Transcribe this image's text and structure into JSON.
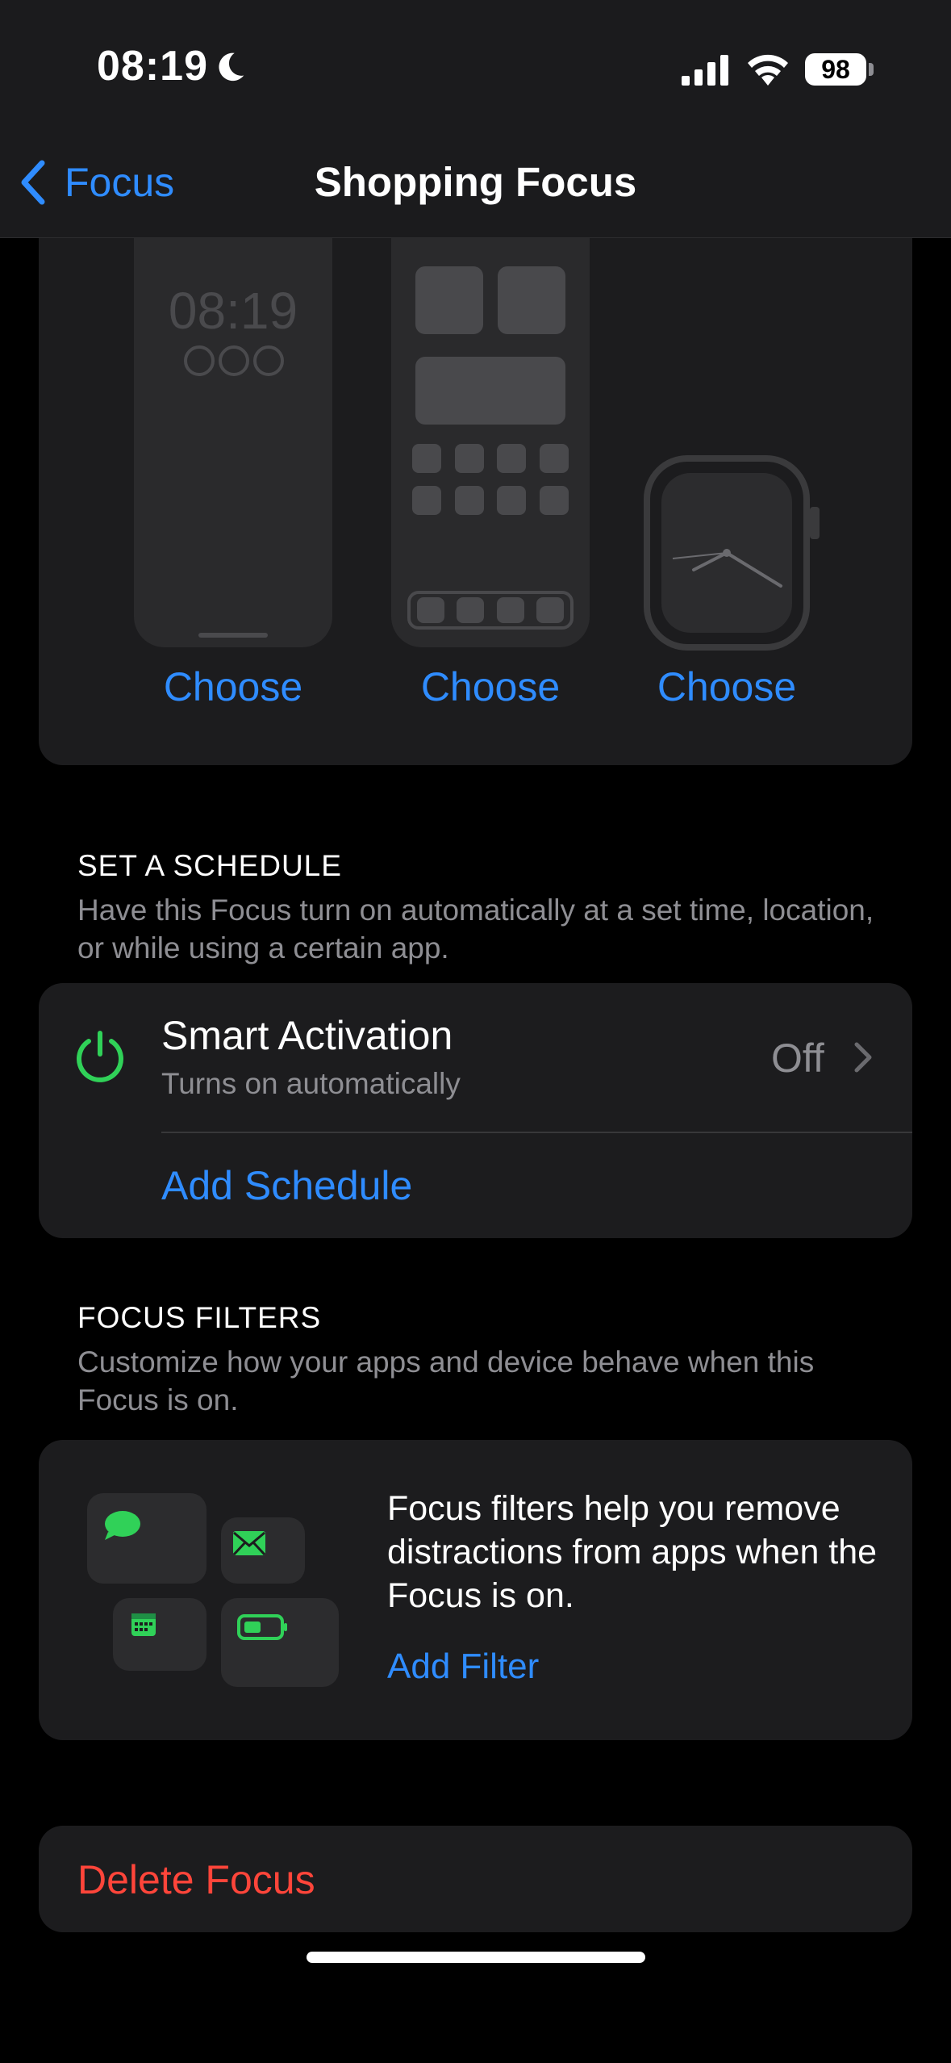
{
  "status": {
    "time": "08:19",
    "battery": "98"
  },
  "nav": {
    "back_label": "Focus",
    "title": "Shopping Focus"
  },
  "preview": {
    "lock_clock": "08:19",
    "choose_labels": [
      "Choose",
      "Choose",
      "Choose"
    ]
  },
  "schedule": {
    "header": "SET A SCHEDULE",
    "description": "Have this Focus turn on automatically at a set time, location, or while using a certain app.",
    "smart_activation": {
      "title": "Smart Activation",
      "subtitle": "Turns on automatically",
      "value": "Off"
    },
    "add_schedule": "Add Schedule"
  },
  "filters": {
    "header": "FOCUS FILTERS",
    "description": "Customize how your apps and device behave when this Focus is on.",
    "info": "Focus filters help you remove distractions from apps when the Focus is on.",
    "add_filter": "Add Filter"
  },
  "delete": {
    "label": "Delete Focus"
  },
  "colors": {
    "accent": "#2f8cff",
    "destructive": "#ff453a",
    "green": "#30d158",
    "card": "#1c1c1e"
  }
}
